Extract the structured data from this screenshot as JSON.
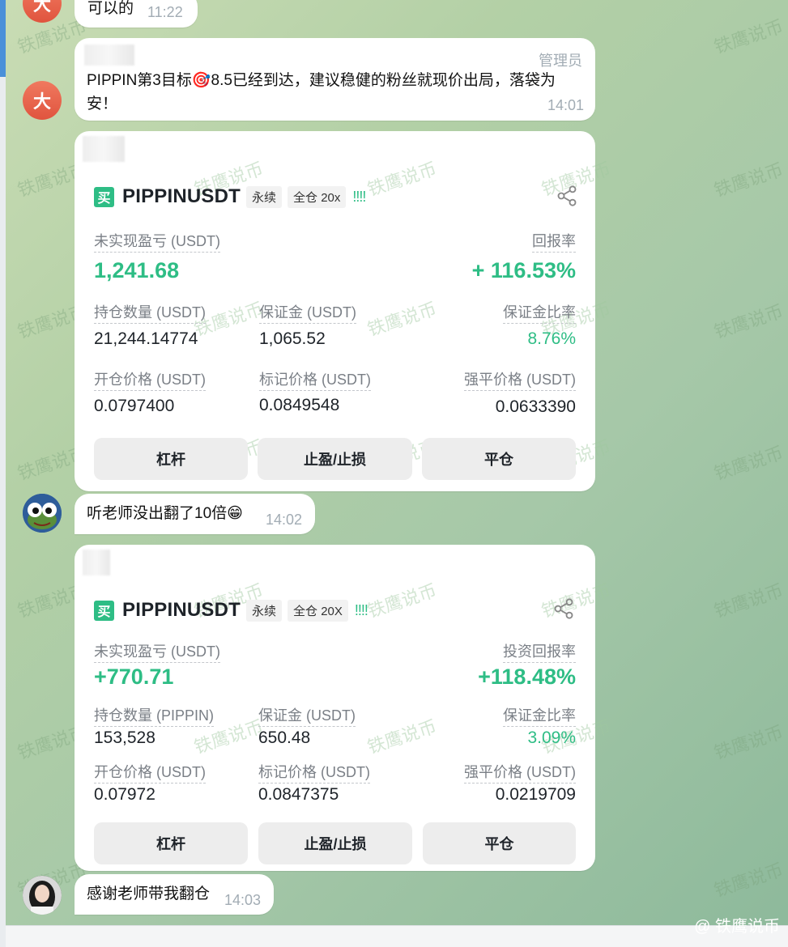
{
  "msg1": {
    "avatar": "大",
    "text": "可以的",
    "time": "11:22"
  },
  "msg2": {
    "avatar": "大",
    "role": "管理员",
    "text": "PIPPIN第3目标🎯8.5已经到达，建议稳健的粉丝就现价出局，落袋为安！",
    "time": "14:01"
  },
  "card1": {
    "buy_tag": "买",
    "symbol": "PIPPINUSDT",
    "chip1": "永续",
    "chip2": "全仓 20x",
    "bars": "!!!!",
    "pnl_label": "未实现盈亏 (USDT)",
    "pnl_value": "1,241.68",
    "roi_label": "回报率",
    "roi_value": "+ 116.53%",
    "size_label": "持仓数量 (USDT)",
    "size_value": "21,244.14774",
    "margin_label": "保证金 (USDT)",
    "margin_value": "1,065.52",
    "ratio_label": "保证金比率",
    "ratio_value": "8.76%",
    "entry_label": "开仓价格 (USDT)",
    "entry_value": "0.0797400",
    "mark_label": "标记价格 (USDT)",
    "mark_value": "0.0849548",
    "liq_label": "强平价格 (USDT)",
    "liq_value": "0.0633390",
    "btn_leverage": "杠杆",
    "btn_tpsl": "止盈/止损",
    "btn_close": "平仓"
  },
  "msg3": {
    "text": "听老师没出翻了10倍😁",
    "time": "14:02"
  },
  "card2": {
    "buy_tag": "买",
    "symbol": "PIPPINUSDT",
    "chip1": "永续",
    "chip2": "全仓 20X",
    "bars": "!!!!",
    "pnl_label": "未实现盈亏 (USDT)",
    "pnl_value": "+770.71",
    "roi_label": "投资回报率",
    "roi_value": "+118.48%",
    "size_label": "持仓数量 (PIPPIN)",
    "size_value": "153,528",
    "margin_label": "保证金 (USDT)",
    "margin_value": "650.48",
    "ratio_label": "保证金比率",
    "ratio_value": "3.09%",
    "entry_label": "开仓价格 (USDT)",
    "entry_value": "0.07972",
    "mark_label": "标记价格 (USDT)",
    "mark_value": "0.0847375",
    "liq_label": "强平价格 (USDT)",
    "liq_value": "0.0219709",
    "btn_leverage": "杠杆",
    "btn_tpsl": "止盈/止损",
    "btn_close": "平仓"
  },
  "msg4": {
    "text": "感谢老师带我翻仓",
    "time": "14:03"
  },
  "watermark": "铁鹰说币",
  "brand": "@ 铁鹰说币",
  "icons": {
    "share": "share-icon",
    "frog": "frog-avatar",
    "girl": "user-avatar"
  },
  "colors": {
    "profit_green": "#2ebd85",
    "avatar_red": "#e0543e"
  }
}
